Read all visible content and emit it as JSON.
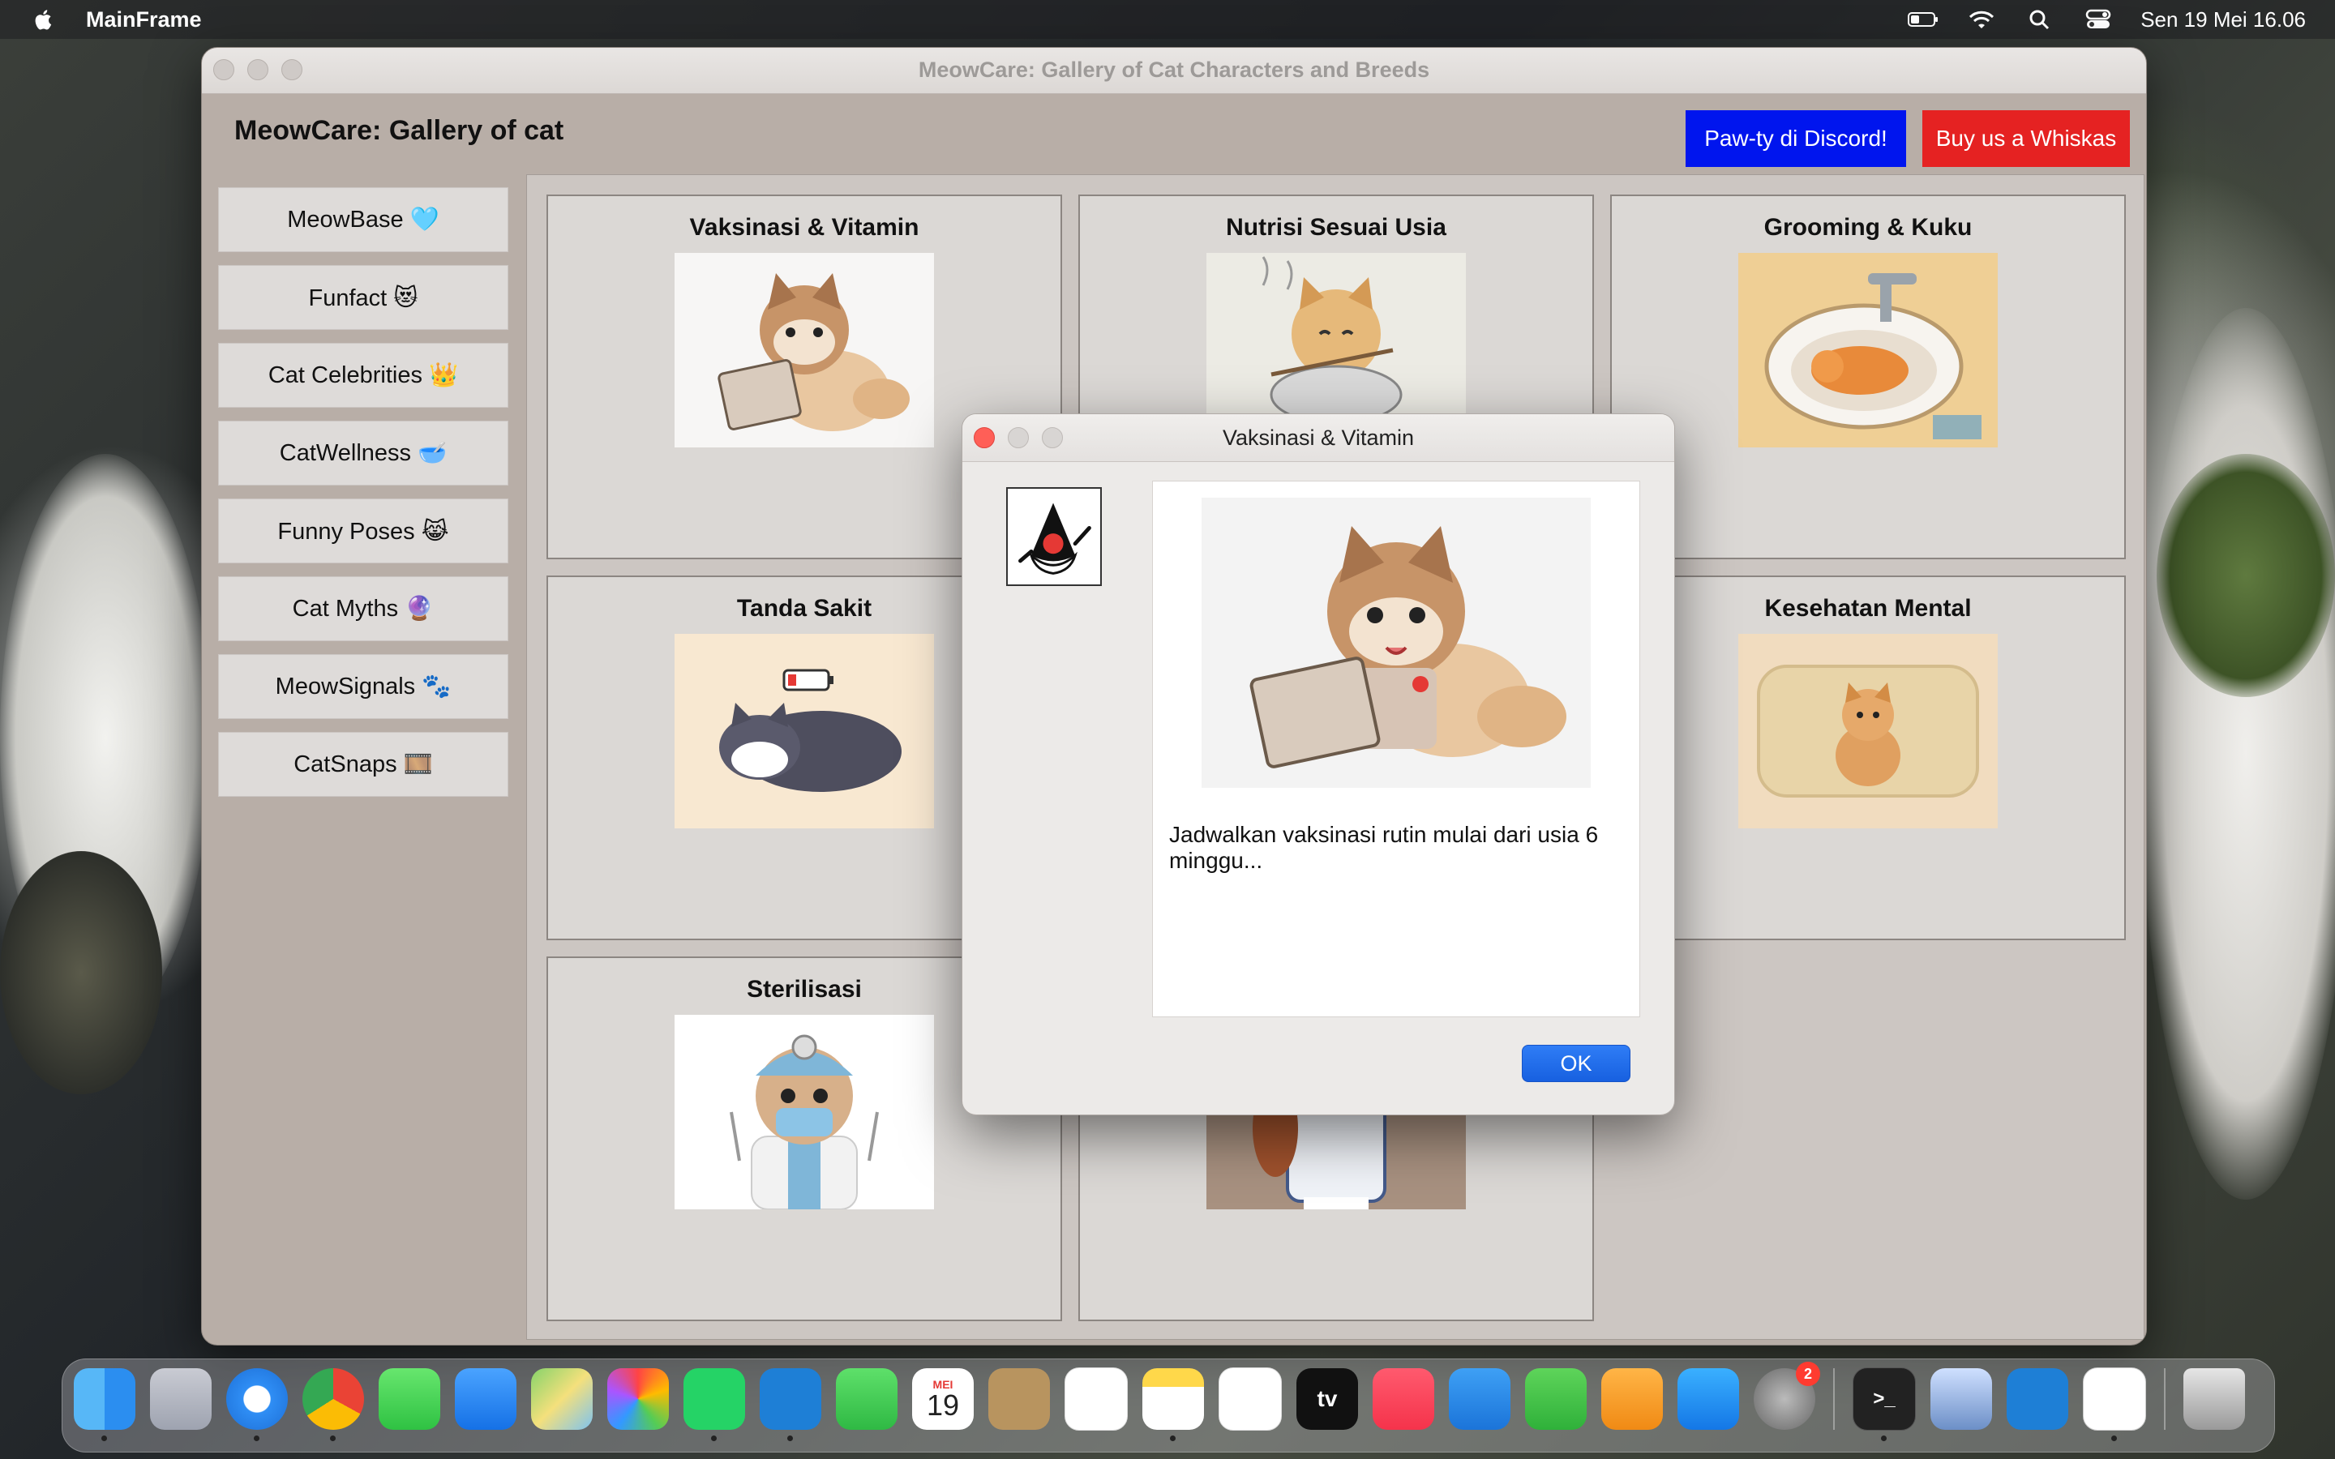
{
  "menubar": {
    "app_name": "MainFrame",
    "datetime": "Sen 19 Mei  16.06"
  },
  "window": {
    "title": "MeowCare: Gallery of Cat Characters and Breeds",
    "app_title": "MeowCare: Gallery of cat",
    "discord_button": "Paw-ty di Discord!",
    "whiskas_button": "Buy us a Whiskas",
    "colors": {
      "discord": "#0015ee",
      "whiskas": "#e52222"
    }
  },
  "sidebar": {
    "items": [
      {
        "label": "MeowBase 🩵"
      },
      {
        "label": "Funfact 😻"
      },
      {
        "label": "Cat Celebrities 👑"
      },
      {
        "label": "CatWellness 🥣"
      },
      {
        "label": "Funny Poses 😹"
      },
      {
        "label": "Cat Myths 🔮"
      },
      {
        "label": "MeowSignals 🐾"
      },
      {
        "label": "CatSnaps 🎞️"
      }
    ]
  },
  "gallery": {
    "cards": [
      {
        "title": "Vaksinasi & Vitamin"
      },
      {
        "title": "Nutrisi Sesuai Usia"
      },
      {
        "title": "Grooming & Kuku"
      },
      {
        "title": "Tanda Sakit"
      },
      {
        "title": ""
      },
      {
        "title": "Kesehatan Mental"
      },
      {
        "title": "Sterilisasi"
      },
      {
        "title": ""
      }
    ]
  },
  "dialog": {
    "title": "Vaksinasi & Vitamin",
    "message": "Jadwalkan vaksinasi rutin mulai dari usia 6 minggu...",
    "ok_label": "OK"
  },
  "dock": {
    "calendar_month": "MEI",
    "calendar_day": "19",
    "tv_label": "tv",
    "settings_badge": "2",
    "terminal_label": ">_"
  }
}
